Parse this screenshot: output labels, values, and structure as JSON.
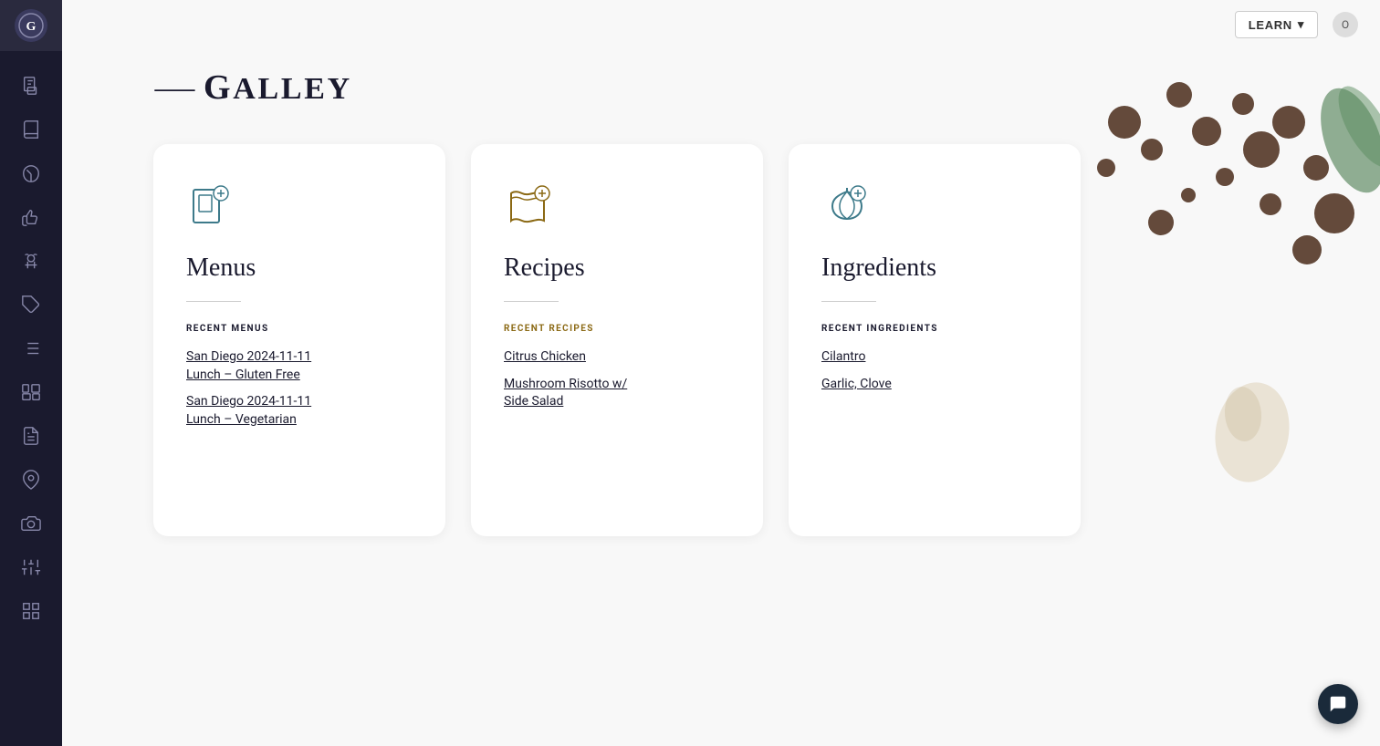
{
  "sidebar": {
    "logo": "G",
    "items": [
      {
        "name": "documents-icon",
        "label": "Documents"
      },
      {
        "name": "recipes-book-icon",
        "label": "Recipe Book"
      },
      {
        "name": "ingredients-icon",
        "label": "Ingredients"
      },
      {
        "name": "thumbs-up-icon",
        "label": "Favorites"
      },
      {
        "name": "chef-icon",
        "label": "Chef"
      },
      {
        "name": "tags-icon",
        "label": "Tags"
      },
      {
        "name": "list-icon",
        "label": "List"
      },
      {
        "name": "cards-icon",
        "label": "Cards"
      },
      {
        "name": "file-icon",
        "label": "File"
      },
      {
        "name": "location-icon",
        "label": "Location"
      },
      {
        "name": "camera-icon",
        "label": "Camera"
      },
      {
        "name": "settings-icon",
        "label": "Settings"
      },
      {
        "name": "grid-icon",
        "label": "Grid"
      }
    ]
  },
  "topbar": {
    "learn_label": "LEARN",
    "avatar_label": "O"
  },
  "brand": {
    "name": "GALLEY",
    "key_symbol": "⸻G"
  },
  "cards": {
    "menus": {
      "title": "Menus",
      "section_label": "RECENT MENUS",
      "items": [
        {
          "text": "San Diego 2024-11-11\nLunch – Gluten Free",
          "id": "menu-1"
        },
        {
          "text": "San Diego 2024-11-11\nLunch – Vegetarian",
          "id": "menu-2"
        }
      ]
    },
    "recipes": {
      "title": "Recipes",
      "section_label": "RECENT RECIPES",
      "items": [
        {
          "text": "Citrus Chicken",
          "id": "recipe-1"
        },
        {
          "text": "Mushroom Risotto w/ Side Salad",
          "id": "recipe-2"
        }
      ]
    },
    "ingredients": {
      "title": "Ingredients",
      "section_label": "RECENT INGREDIENTS",
      "items": [
        {
          "text": "Cilantro",
          "id": "ingredient-1"
        },
        {
          "text": "Garlic, Clove",
          "id": "ingredient-2"
        }
      ]
    }
  },
  "chat": {
    "icon": "💬"
  }
}
